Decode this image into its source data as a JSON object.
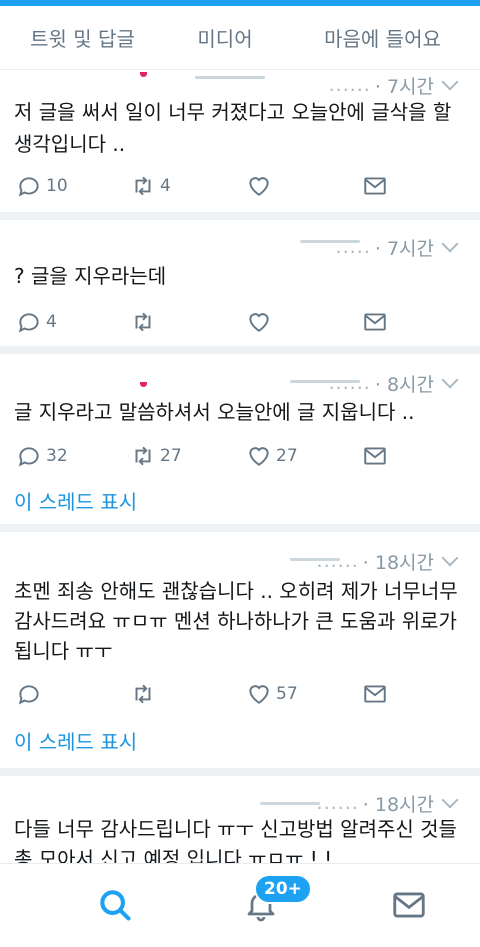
{
  "tabs": [
    {
      "label": "트윗 및 답글"
    },
    {
      "label": "미디어"
    },
    {
      "label": "마음에 들어요"
    }
  ],
  "tweets": [
    {
      "time": "· 7시간",
      "dots": "......",
      "text": "저 글을 써서 일이 너무 커졌다고 오늘안에 글삭을 할 생각입니다 ..",
      "replies": "10",
      "retweets": "4",
      "likes": ""
    },
    {
      "time": "· 7시간",
      "dots": ".....",
      "text": "? 글을 지우라는데",
      "replies": "4",
      "retweets": "",
      "likes": ""
    },
    {
      "time": "· 8시간",
      "dots": "......",
      "text": "글 지우라고 말씀하셔서 오늘안에 글 지웁니다 ..",
      "replies": "32",
      "retweets": "27",
      "likes": "27",
      "thread": "이 스레드 표시"
    },
    {
      "time": "· 18시간",
      "dots": "......",
      "text": "초멘 죄송 안해도 괜찮습니다 .. 오히려 제가 너무너무 감사드려요 ㅠㅁㅠ 멘션 하나하나가 큰 도움과 위로가 됩니다 ㅠㅜ",
      "replies": "",
      "retweets": "",
      "likes": "57",
      "thread": "이 스레드 표시"
    },
    {
      "time": "· 18시간",
      "dots": "......",
      "text": "다들 너무 감사드립니다 ㅠㅜ 신고방법 알려주신 것들 총 모아서 신고 예정 입니다 ㅠㅁㅠ ! !"
    }
  ],
  "bottom_nav": {
    "badge": "20+"
  },
  "colors": {
    "accent": "#1da1f2",
    "link": "#1b95e0",
    "muted": "#657786"
  }
}
